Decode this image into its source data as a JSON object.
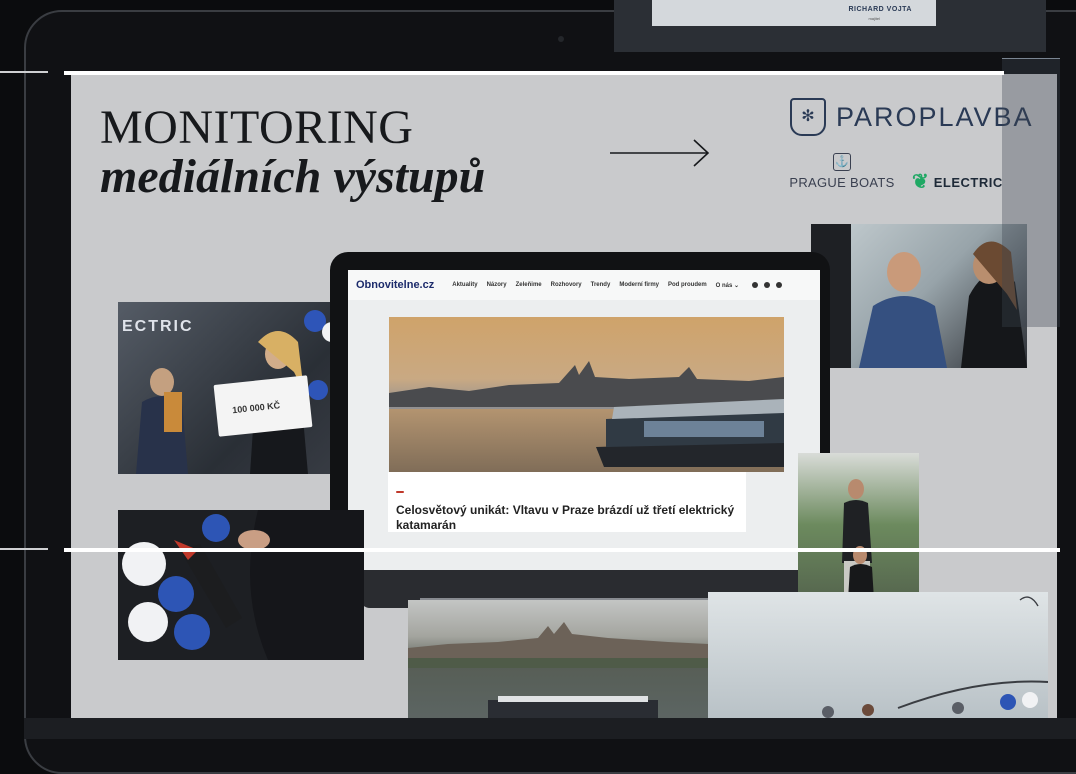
{
  "slide": {
    "title_line1": "MONITORING",
    "title_line2": "mediálních výstupů"
  },
  "brands": {
    "paroplavba": "PAROPLAVBA",
    "prague_boats": "PRAGUE BOATS",
    "prague_boats_sub": "",
    "electric": "ELECTRIC"
  },
  "website": {
    "logo": "Obnovitelne.cz",
    "nav_items": [
      "Aktuality",
      "Názory",
      "Zeleňime",
      "Rozhovory",
      "Trendy",
      "Moderní firmy",
      "Pod proudem",
      "O nás ⌄"
    ],
    "tag": "",
    "headline": "Celosvětový unikát: Vltavu v Praze brázdí už třetí elektrický katamarán"
  },
  "photos": {
    "award_label": "ECTRIC",
    "check_amount": "100 000 KČ",
    "sign_name": "RICHARD VOJTA",
    "sign_role": "majitel"
  },
  "colors": {
    "background": "#0b0c0e",
    "slide": "#c9cacc",
    "brand_navy": "#2a3a55",
    "electric_green": "#1fa864"
  },
  "icons": {
    "paroplavba": "shield-snowflake-icon",
    "prague_boats": "anchor-badge-icon",
    "electric": "leaf-bolt-icon",
    "arrow": "long-right-arrow-icon"
  }
}
